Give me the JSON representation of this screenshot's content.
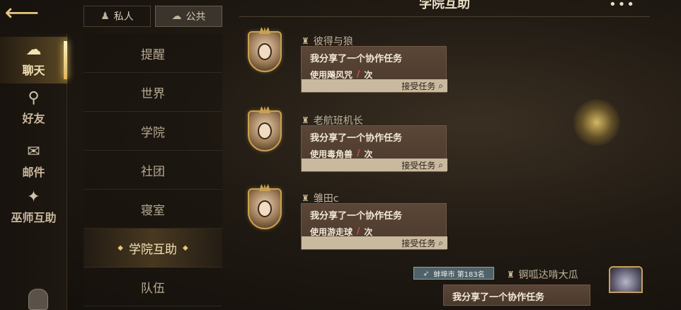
{
  "header": {
    "title": "学院互助",
    "more_label": "•••"
  },
  "rail": {
    "items": [
      {
        "label": "聊天",
        "icon": "speech-bubble-icon",
        "glyph": "☁"
      },
      {
        "label": "好友",
        "icon": "witch-hat-icon",
        "glyph": "⚲"
      },
      {
        "label": "邮件",
        "icon": "envelope-icon",
        "glyph": "✉"
      },
      {
        "label": "巫师互助",
        "icon": "wizard-help-icon",
        "glyph": "✦"
      }
    ],
    "active_index": 0
  },
  "scope_tabs": {
    "private_label": "私人",
    "public_label": "公共",
    "private_icon": "♟",
    "public_icon": "☁"
  },
  "channels": {
    "items": [
      "提醒",
      "世界",
      "学院",
      "社团",
      "寝室",
      "学院互助",
      "队伍"
    ],
    "active_index": 5
  },
  "messages": [
    {
      "sender": "彼得与狼",
      "title": "我分享了一个协作任务",
      "sub_prefix": "使用飚风咒",
      "slash": "/",
      "sub_suffix": "次",
      "accept_label": "接受任务"
    },
    {
      "sender": "老航班机长",
      "title": "我分享了一个协作任务",
      "sub_prefix": "使用毒角兽",
      "slash": "/",
      "sub_suffix": "次",
      "accept_label": "接受任务"
    },
    {
      "sender": "雏田c",
      "title": "我分享了一个协作任务",
      "sub_prefix": "使用游走球",
      "slash": "/",
      "sub_suffix": "次",
      "accept_label": "接受任务"
    }
  ],
  "partial_message": {
    "city_tag": "蚌埠市 第183名",
    "sender": "锕呱达啃大瓜",
    "text": "我分享了一个协作任务"
  },
  "colors": {
    "accent_gold": "#e6c77a",
    "bubble": "#5b4637",
    "accept_bar": "#c9b99f",
    "slash_red": "#d9534f"
  }
}
